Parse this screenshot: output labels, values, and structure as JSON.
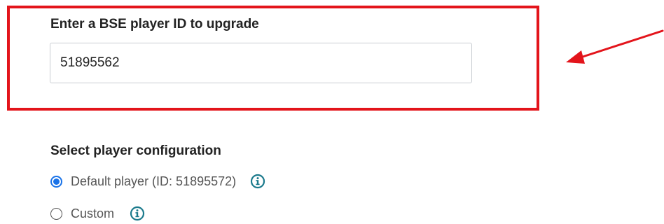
{
  "upgrade": {
    "label": "Enter a BSE player ID to upgrade",
    "player_id_value": "51895562"
  },
  "configuration": {
    "heading": "Select player configuration",
    "options": [
      {
        "label": "Default player (ID: 51895572)",
        "selected": true
      },
      {
        "label": "Custom",
        "selected": false
      }
    ]
  },
  "colors": {
    "highlight": "#e3141b",
    "radio_selected": "#1a73e8",
    "info_icon": "#1b7a8c"
  },
  "icons": {
    "info": "info-icon",
    "annotation_arrow": "arrow-icon"
  }
}
